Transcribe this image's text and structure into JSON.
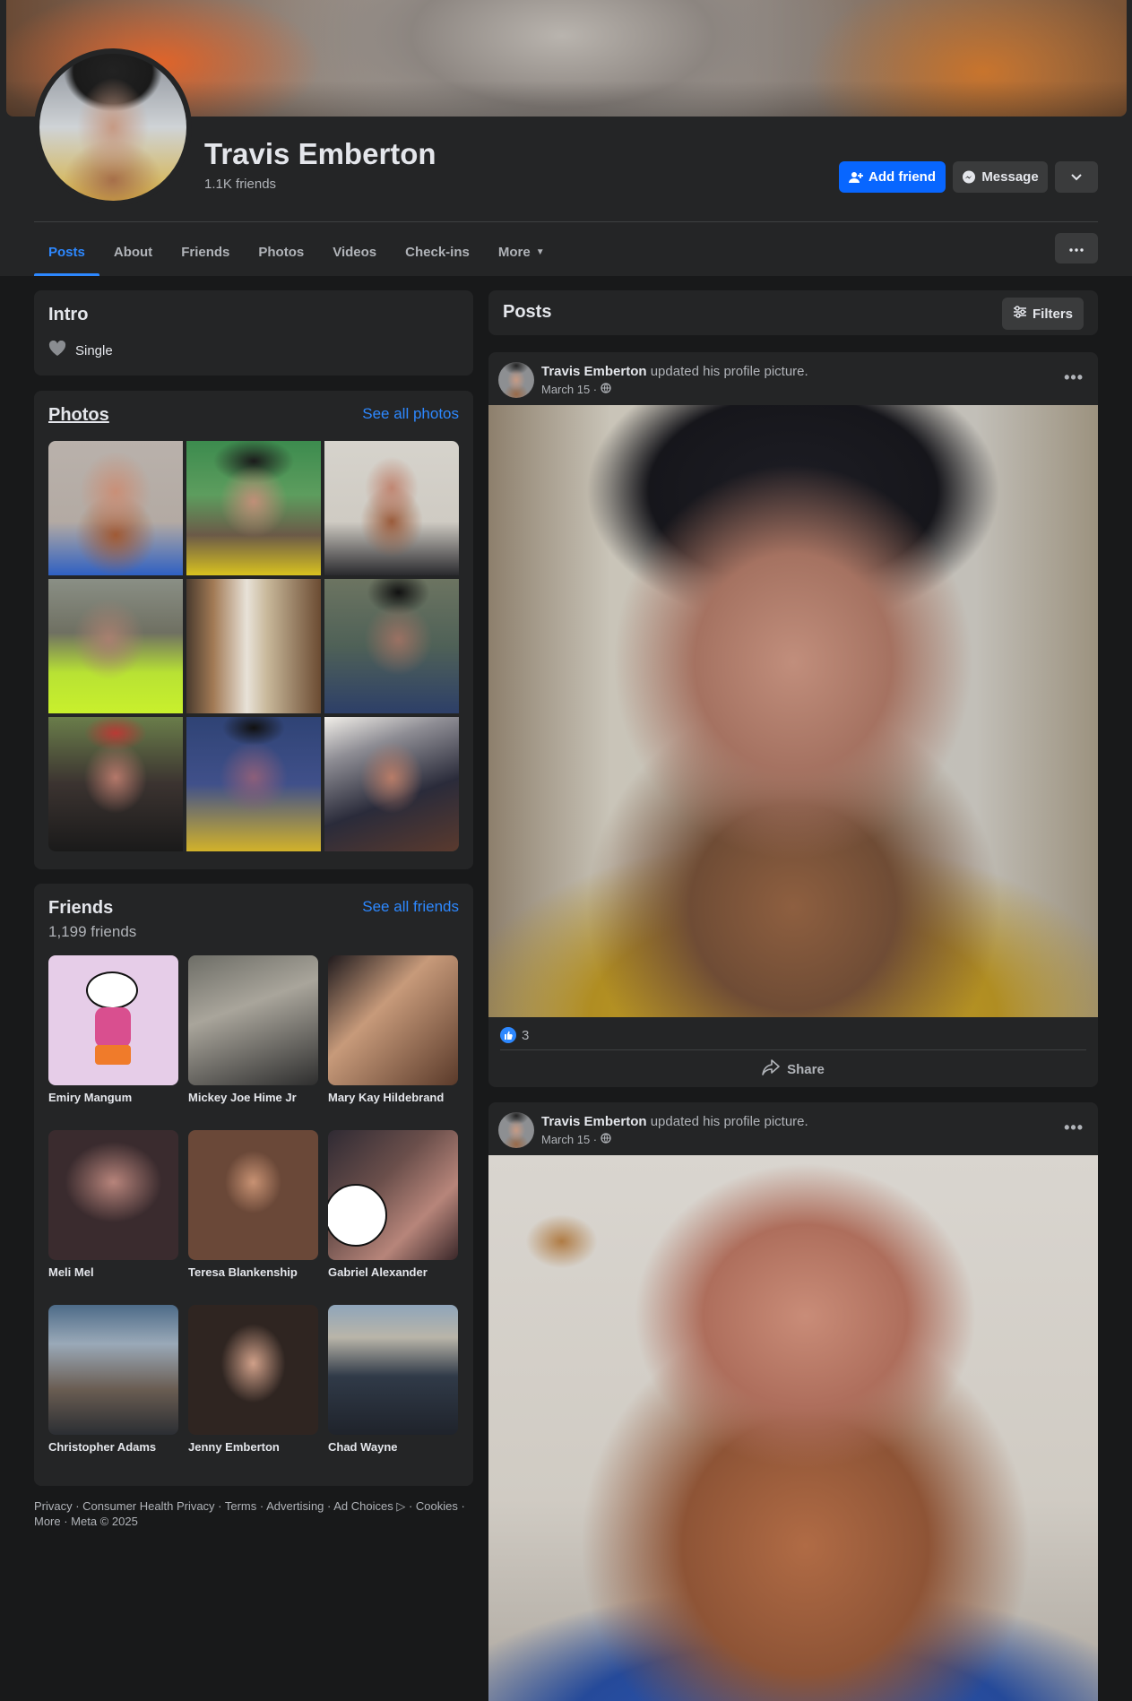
{
  "profile": {
    "name": "Travis Emberton",
    "friends_summary": "1.1K friends",
    "add_friend_label": "Add friend",
    "message_label": "Message"
  },
  "tabs": [
    "Posts",
    "About",
    "Friends",
    "Photos",
    "Videos",
    "Check-ins",
    "More"
  ],
  "intro": {
    "title": "Intro",
    "relationship": "Single"
  },
  "photos": {
    "title": "Photos",
    "see_all": "See all photos"
  },
  "friends": {
    "title": "Friends",
    "count": "1,199 friends",
    "see_all": "See all friends",
    "list": [
      {
        "name": "Emiry Mangum"
      },
      {
        "name": "Mickey Joe Hime Jr"
      },
      {
        "name": "Mary Kay Hildebrand"
      },
      {
        "name": "Meli Mel"
      },
      {
        "name": "Teresa Blankenship"
      },
      {
        "name": "Gabriel Alexander"
      },
      {
        "name": "Christopher Adams"
      },
      {
        "name": "Jenny Emberton"
      },
      {
        "name": "Chad Wayne"
      }
    ]
  },
  "footer": {
    "line1": "Privacy · Consumer Health Privacy · Terms · Advertising · Ad Choices ▷ · Cookies ·",
    "line2": "More · Meta © 2025"
  },
  "posts": {
    "title": "Posts",
    "filters_label": "Filters",
    "items": [
      {
        "author": "Travis Emberton",
        "action": "updated his profile picture.",
        "date": "March 15 ·",
        "reactions": "3",
        "share_label": "Share"
      },
      {
        "author": "Travis Emberton",
        "action": "updated his profile picture.",
        "date": "March 15 ·"
      }
    ]
  },
  "colors": {
    "background": "#18191a",
    "card": "#242526",
    "accent": "#0866ff",
    "link": "#2d88ff"
  }
}
